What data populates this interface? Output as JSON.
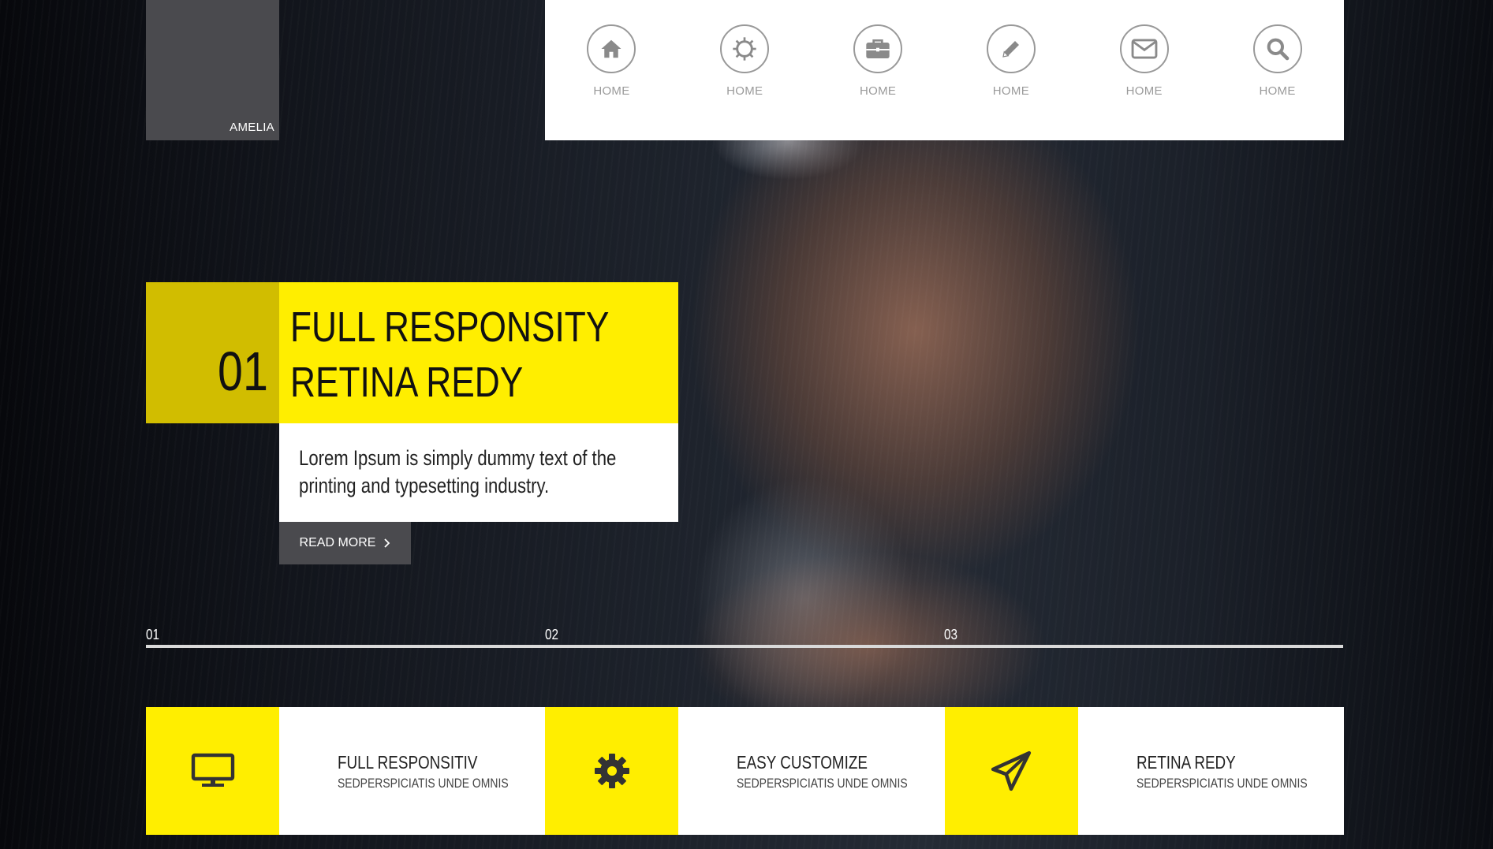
{
  "brand": {
    "logo_text": "AMELIA"
  },
  "nav": {
    "items": [
      {
        "label": "HOME",
        "icon": "home-icon"
      },
      {
        "label": "HOME",
        "icon": "gear-icon"
      },
      {
        "label": "HOME",
        "icon": "briefcase-icon"
      },
      {
        "label": "HOME",
        "icon": "pencil-icon"
      },
      {
        "label": "HOME",
        "icon": "envelope-icon"
      },
      {
        "label": "HOME",
        "icon": "search-icon"
      }
    ]
  },
  "hero": {
    "number": "01",
    "title_line1": "FULL RESPONSITY",
    "title_line2": "RETINA REDY",
    "description": "Lorem Ipsum is simply dummy text of the printing and typesetting industry.",
    "button_label": "READ MORE",
    "button_icon": "chevron-right-icon"
  },
  "progress": {
    "steps": [
      "01",
      "02",
      "03"
    ]
  },
  "features": [
    {
      "icon": "monitor-icon",
      "title": "FULL RESPONSITIV",
      "subtitle": "SEDPERSPICIATIS UNDE OMNIS"
    },
    {
      "icon": "gear-icon",
      "title": "EASY CUSTOMIZE",
      "subtitle": "SEDPERSPICIATIS UNDE OMNIS"
    },
    {
      "icon": "paper-plane-icon",
      "title": "RETINA REDY",
      "subtitle": "SEDPERSPICIATIS UNDE OMNIS"
    }
  ],
  "colors": {
    "accent_yellow": "#ffee00",
    "accent_dark_yellow": "#d1bd00",
    "tile_gray": "#4a4a4e",
    "white": "#ffffff"
  }
}
